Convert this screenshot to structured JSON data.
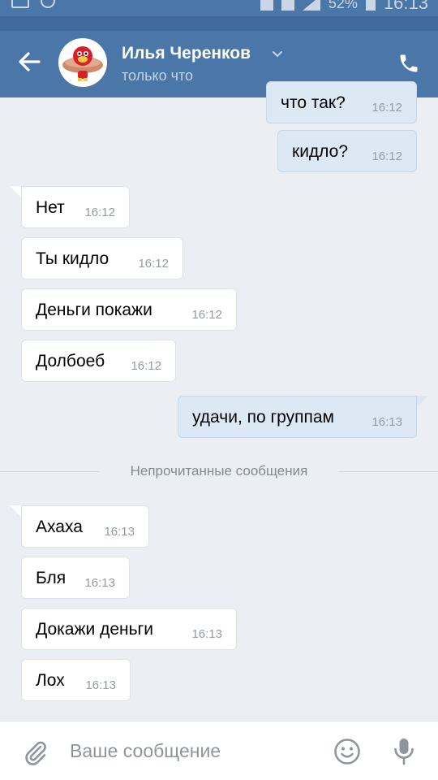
{
  "status_bar": {
    "battery": "52%",
    "time": "16:13"
  },
  "header": {
    "contact_name": "Илья Черенков",
    "contact_status": "только что"
  },
  "messages": [
    {
      "dir": "out",
      "text": "что так?",
      "time": "16:12"
    },
    {
      "dir": "out",
      "text": "кидло?",
      "time": "16:12"
    },
    {
      "dir": "in",
      "text": "Нет",
      "time": "16:12"
    },
    {
      "dir": "in",
      "text": "Ты кидло",
      "time": "16:12"
    },
    {
      "dir": "in",
      "text": "Деньги покажи",
      "time": "16:12"
    },
    {
      "dir": "in",
      "text": "Долбоеб",
      "time": "16:12"
    },
    {
      "dir": "out",
      "text": "удачи, по группам",
      "time": "16:13"
    },
    {
      "dir": "in",
      "text": "Ахаха",
      "time": "16:13"
    },
    {
      "dir": "in",
      "text": "Бля",
      "time": "16:13"
    },
    {
      "dir": "in",
      "text": "Докажи деньги",
      "time": "16:13"
    },
    {
      "dir": "in",
      "text": "Лох",
      "time": "16:13"
    }
  ],
  "unread_divider": "Непрочитанные сообщения",
  "composer": {
    "placeholder": "Ваше сообщение"
  },
  "colors": {
    "header": "#4a76a8",
    "background": "#ebeef2",
    "outgoing": "#dde8f5",
    "incoming": "#ffffff"
  },
  "icons": [
    "back-arrow-icon",
    "chevron-down-icon",
    "phone-icon",
    "attach-icon",
    "smile-icon",
    "mic-icon"
  ]
}
